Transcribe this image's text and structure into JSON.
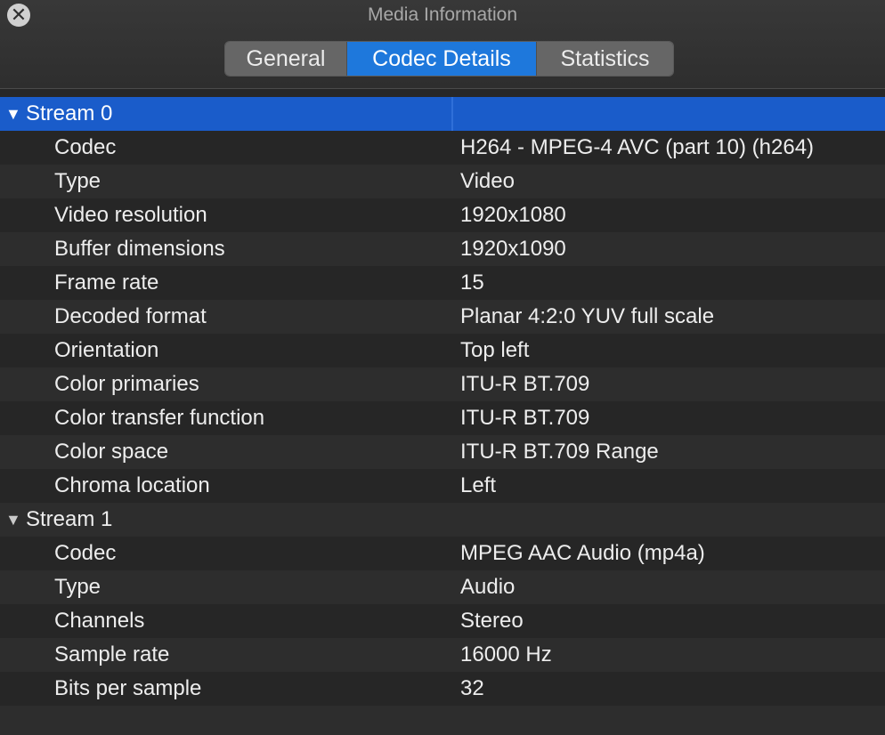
{
  "window": {
    "title": "Media Information",
    "close_glyph": "✕",
    "close_icon": "close-icon"
  },
  "tabs": [
    {
      "label": "General",
      "active": false
    },
    {
      "label": "Codec Details",
      "active": true
    },
    {
      "label": "Statistics",
      "active": false
    }
  ],
  "streams": [
    {
      "label": "Stream 0",
      "expanded": true,
      "selected": true,
      "toggle_glyph": "▼",
      "properties": [
        {
          "key": "Codec",
          "value": "H264 - MPEG-4 AVC (part 10) (h264)"
        },
        {
          "key": "Type",
          "value": "Video"
        },
        {
          "key": "Video resolution",
          "value": "1920x1080"
        },
        {
          "key": "Buffer dimensions",
          "value": "1920x1090"
        },
        {
          "key": "Frame rate",
          "value": "15"
        },
        {
          "key": "Decoded format",
          "value": "Planar 4:2:0 YUV full scale"
        },
        {
          "key": "Orientation",
          "value": "Top left"
        },
        {
          "key": "Color primaries",
          "value": "ITU-R BT.709"
        },
        {
          "key": "Color transfer function",
          "value": "ITU-R BT.709"
        },
        {
          "key": "Color space",
          "value": "ITU-R BT.709 Range"
        },
        {
          "key": "Chroma location",
          "value": "Left"
        }
      ]
    },
    {
      "label": "Stream 1",
      "expanded": true,
      "selected": false,
      "toggle_glyph": "▼",
      "properties": [
        {
          "key": "Codec",
          "value": "MPEG AAC Audio (mp4a)"
        },
        {
          "key": "Type",
          "value": "Audio"
        },
        {
          "key": "Channels",
          "value": "Stereo"
        },
        {
          "key": "Sample rate",
          "value": "16000 Hz"
        },
        {
          "key": "Bits per sample",
          "value": "32"
        }
      ]
    }
  ],
  "colors": {
    "accent": "#1e78dc",
    "selection": "#1a5cca",
    "background": "#262626",
    "text": "#ededed"
  }
}
